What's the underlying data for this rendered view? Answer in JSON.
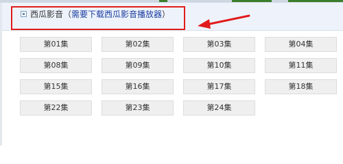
{
  "source": {
    "icon": "square-marker-icon",
    "name": "西瓜影音",
    "note_open": "（",
    "note_link": "需要下载西瓜影音播放器",
    "note_close": "）"
  },
  "episodes": [
    [
      "第01集",
      "第02集",
      "第03集",
      "第04集"
    ],
    [
      "第08集",
      "第09集",
      "第10集",
      "第11集"
    ],
    [
      "第15集",
      "第16集",
      "第17集",
      "第18集"
    ],
    [
      "第22集",
      "第23集",
      "第24集"
    ]
  ],
  "colors": {
    "highlight": "#e11b1b",
    "link": "#1a3c9e",
    "button_bg": "#efefef"
  }
}
